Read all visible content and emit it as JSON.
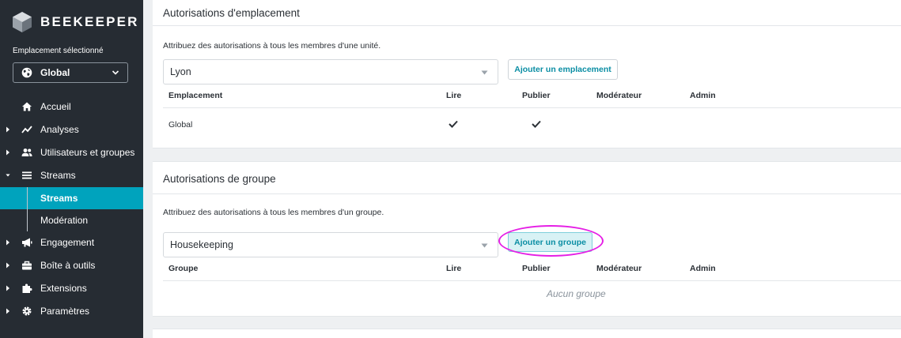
{
  "sidebar": {
    "brand": "BEEKEEPER",
    "location_label": "Emplacement sélectionné",
    "location_value": "Global",
    "nav": [
      {
        "label": "Accueil",
        "icon": "home-icon"
      },
      {
        "label": "Analyses",
        "icon": "trend-icon"
      },
      {
        "label": "Utilisateurs et groupes",
        "icon": "users-icon"
      },
      {
        "label": "Streams",
        "icon": "list-icon"
      },
      {
        "label": "Engagement",
        "icon": "megaphone-icon"
      },
      {
        "label": "Boîte à outils",
        "icon": "toolbox-icon"
      },
      {
        "label": "Extensions",
        "icon": "puzzle-icon"
      },
      {
        "label": "Paramètres",
        "icon": "gear-icon"
      }
    ],
    "streams_sub": [
      {
        "label": "Streams",
        "active": true
      },
      {
        "label": "Modération",
        "active": false
      }
    ]
  },
  "location_permissions": {
    "title": "Autorisations d'emplacement",
    "description": "Attribuez des autorisations à tous les membres d'une unité.",
    "dropdown_value": "Lyon",
    "add_button": "Ajouter un emplacement",
    "columns": [
      "Emplacement",
      "Lire",
      "Publier",
      "Modérateur",
      "Admin"
    ],
    "rows": [
      {
        "name": "Global",
        "read": true,
        "publish": true,
        "moderator": false,
        "admin": false
      }
    ]
  },
  "group_permissions": {
    "title": "Autorisations de groupe",
    "description": "Attribuez des autorisations à tous les membres d'un groupe.",
    "dropdown_value": "Housekeeping",
    "add_button": "Ajouter un groupe",
    "columns": [
      "Groupe",
      "Lire",
      "Publier",
      "Modérateur",
      "Admin"
    ],
    "empty_message": "Aucun groupe"
  },
  "colors": {
    "sidebar_bg": "#262c33",
    "accent": "#00a3bd",
    "highlight_ring": "#e51fe5"
  }
}
